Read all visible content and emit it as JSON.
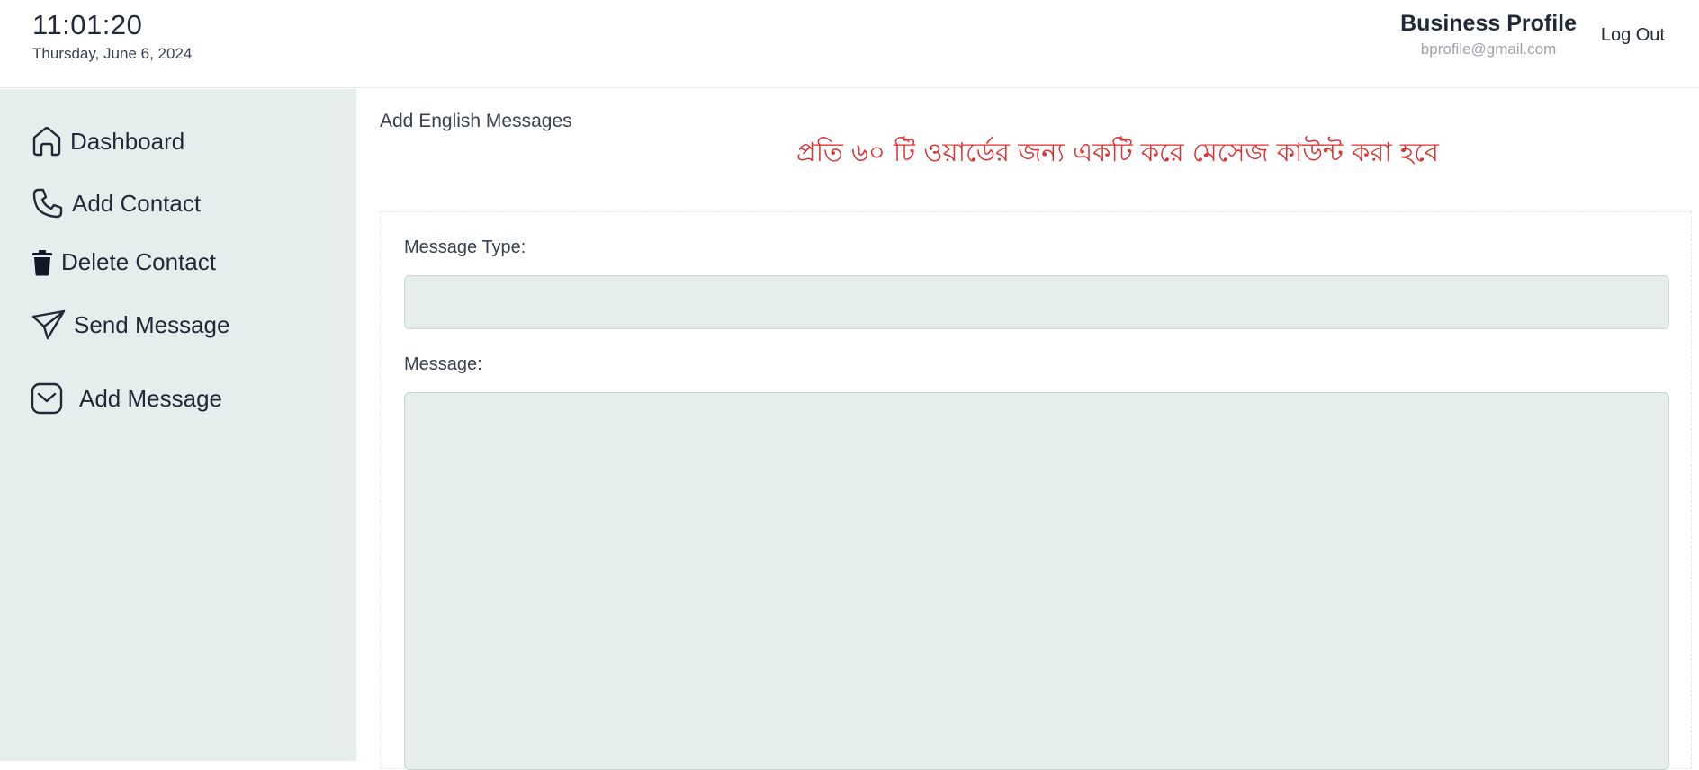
{
  "header": {
    "time": "11:01:20",
    "date": "Thursday, June 6, 2024",
    "profile_name": "Business Profile",
    "profile_email": "bprofile@gmail.com",
    "logout_label": "Log Out"
  },
  "sidebar": {
    "items": [
      {
        "label": "Dashboard",
        "icon": "home-icon"
      },
      {
        "label": "Add Contact",
        "icon": "phone-icon"
      },
      {
        "label": "Delete Contact",
        "icon": "trash-icon"
      },
      {
        "label": "Send Message",
        "icon": "send-icon"
      },
      {
        "label": "Add Message",
        "icon": "message-icon"
      }
    ]
  },
  "main": {
    "heading": "Add English Messages",
    "notice": "প্রতি ৬০ টি ওয়ার্ডের জন্য একটি করে মেসেজ কাউন্ট করা হবে",
    "notice_color": "#e03131",
    "form": {
      "message_type_label": "Message Type:",
      "message_type_value": "",
      "message_label": "Message:",
      "message_value": ""
    }
  },
  "colors": {
    "sidebar_bg": "#e5eeec",
    "input_bg": "#e5eeec"
  }
}
